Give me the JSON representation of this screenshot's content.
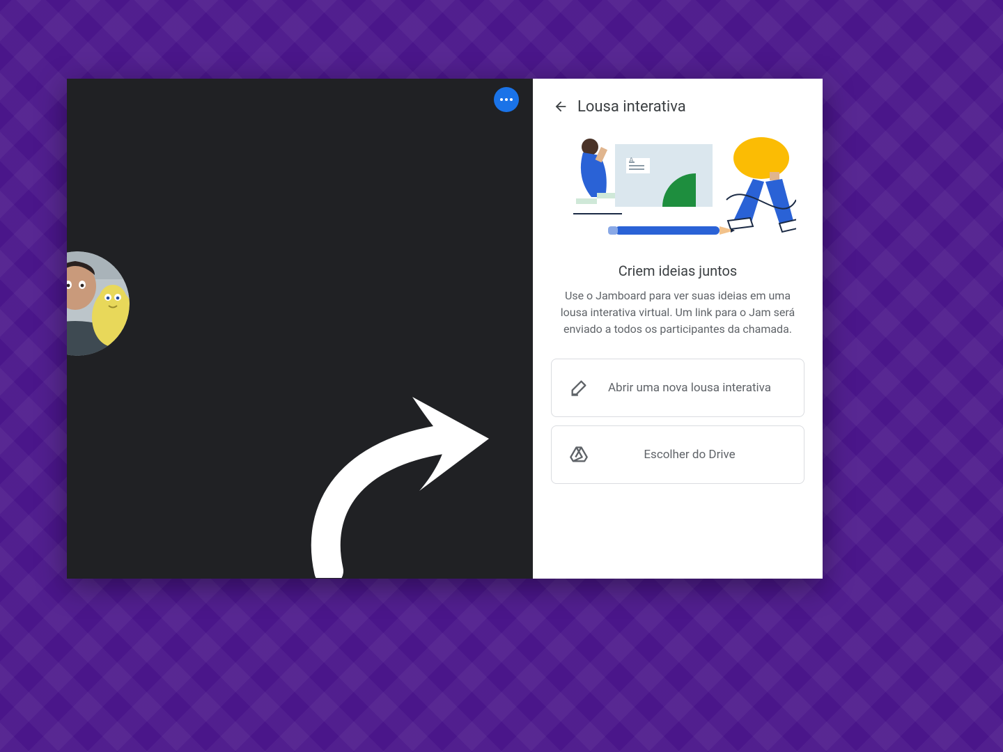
{
  "panel": {
    "title": "Lousa interativa",
    "promo_title": "Criem ideias juntos",
    "promo_desc": "Use o Jamboard para ver suas ideias em uma lousa interativa virtual. Um link para o Jam será enviado a todos os participantes da chamada."
  },
  "options": {
    "new": "Abrir uma nova lousa interativa",
    "drive": "Escolher do Drive"
  }
}
